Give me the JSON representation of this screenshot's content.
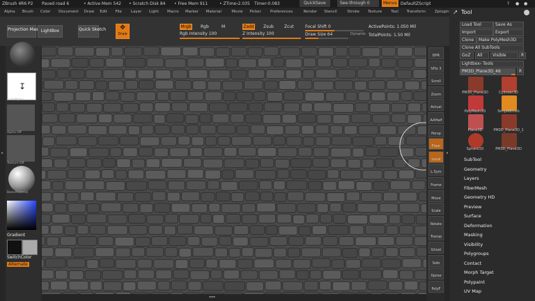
{
  "titlebar": {
    "app": "ZBrush 4R6 P2",
    "doc": "Paved road 6",
    "active_mem": "• Active Mem 542",
    "scratch_disk": "• Scratch Disk 84",
    "free_mem": "• Free Mem 911",
    "ztime": "• ZTime›2.035",
    "timer": "Timer›0.083",
    "quicksave": "QuickSave",
    "see_through": "See-through",
    "see_through_value": "0",
    "menus": "Menus",
    "default_script": "DefaultZScript"
  },
  "menubar": [
    "Alpha",
    "Brush",
    "Color",
    "Document",
    "Draw",
    "Edit",
    "File",
    "Layer",
    "Light",
    "Macro",
    "Marker",
    "Material",
    "Movie",
    "Picker",
    "Preferences",
    "Render",
    "Stencil",
    "Stroke",
    "Texture",
    "Tool",
    "Transform",
    "Zplugin",
    "Zscript"
  ],
  "topbar": {
    "projection_master": "Projection Master",
    "lightbox": "LightBox",
    "quick_sketch": "Quick Sketch",
    "draw": "Draw",
    "mrgb": "Mrgb",
    "rgb": "Rgb",
    "m": "M",
    "rgb_intensity_label": "Rgb Intensity",
    "rgb_intensity_value": "100",
    "rgb_intensity_level": 1.0,
    "zadd": "Zadd",
    "zsub": "Zsub",
    "zcut": "Zcut",
    "z_intensity_label": "Z Intensity",
    "z_intensity_value": "100",
    "z_intensity_level": 1.0,
    "focal_shift_label": "Focal Shift",
    "focal_shift_value": "0",
    "focal_shift_level": 0.5,
    "draw_size_label": "Draw Size",
    "draw_size_value": "64",
    "draw_size_level": 0.3,
    "dynamic": "Dynamic",
    "active_points": "ActivePoints: 1.050 Mil",
    "total_points": "TotalPoints: 1.50 Mil"
  },
  "leftpanel": {
    "brush_label": "GrabAlpha",
    "alpha_label": "Alpha Off",
    "texture_label": "Texture Off",
    "material_label": "BasicMaterial",
    "gradient": "Gradient",
    "switchcolor": "SwitchColor",
    "alternate": "Alternate"
  },
  "rightstrip": [
    "BPR",
    "SPix 3",
    "Scroll",
    "Zoom",
    "Actual",
    "AAHalf",
    "Persp",
    "Floor",
    "Local",
    "L.Sym",
    "Frame",
    "Move",
    "Scale",
    "Rotate",
    "Transp",
    "Ghost",
    "Solo",
    "Xpose",
    "PolyF"
  ],
  "toolpanel": {
    "title": "Tool",
    "load_tool": "Load Tool",
    "save_as": "Save As",
    "import": "Import",
    "export": "Export",
    "clone": "Clone",
    "make_polymesh": "Make PolyMesh3D",
    "clone_all_subtools": "Clone All SubTools",
    "goz": "GoZ",
    "all": "All",
    "visible": "Visible",
    "r": "R",
    "lightbox_tools": "Lightbox› Tools",
    "current_tool": "PM3D_Plane3D_46",
    "current_tool_r": "R",
    "thumbs": [
      {
        "label": "PM3D_Plane3D",
        "color": "#8a3a2a"
      },
      {
        "label": "Cylinder3D",
        "color": "#b04030"
      },
      {
        "label": "PolyMesh3D",
        "color": "#c03a3a"
      },
      {
        "label": "SimpleBrush",
        "color": "#e08a20"
      },
      {
        "label": "Plane3D",
        "color": "#c05050"
      },
      {
        "label": "PM3D_Plane3D_1",
        "color": "#8a3a2a"
      },
      {
        "label": "Sphere3D",
        "color": "#b03a2a"
      },
      {
        "label": "PM3D_Plane3D",
        "color": "#7a3a2a"
      }
    ],
    "menu": [
      "SubTool",
      "Geometry",
      "Layers",
      "FiberMesh",
      "Geometry HD",
      "Preview",
      "Surface",
      "Deformation",
      "Masking",
      "Visibility",
      "Polygroups",
      "Contact",
      "Morph Target",
      "Polypaint",
      "UV Map"
    ]
  }
}
